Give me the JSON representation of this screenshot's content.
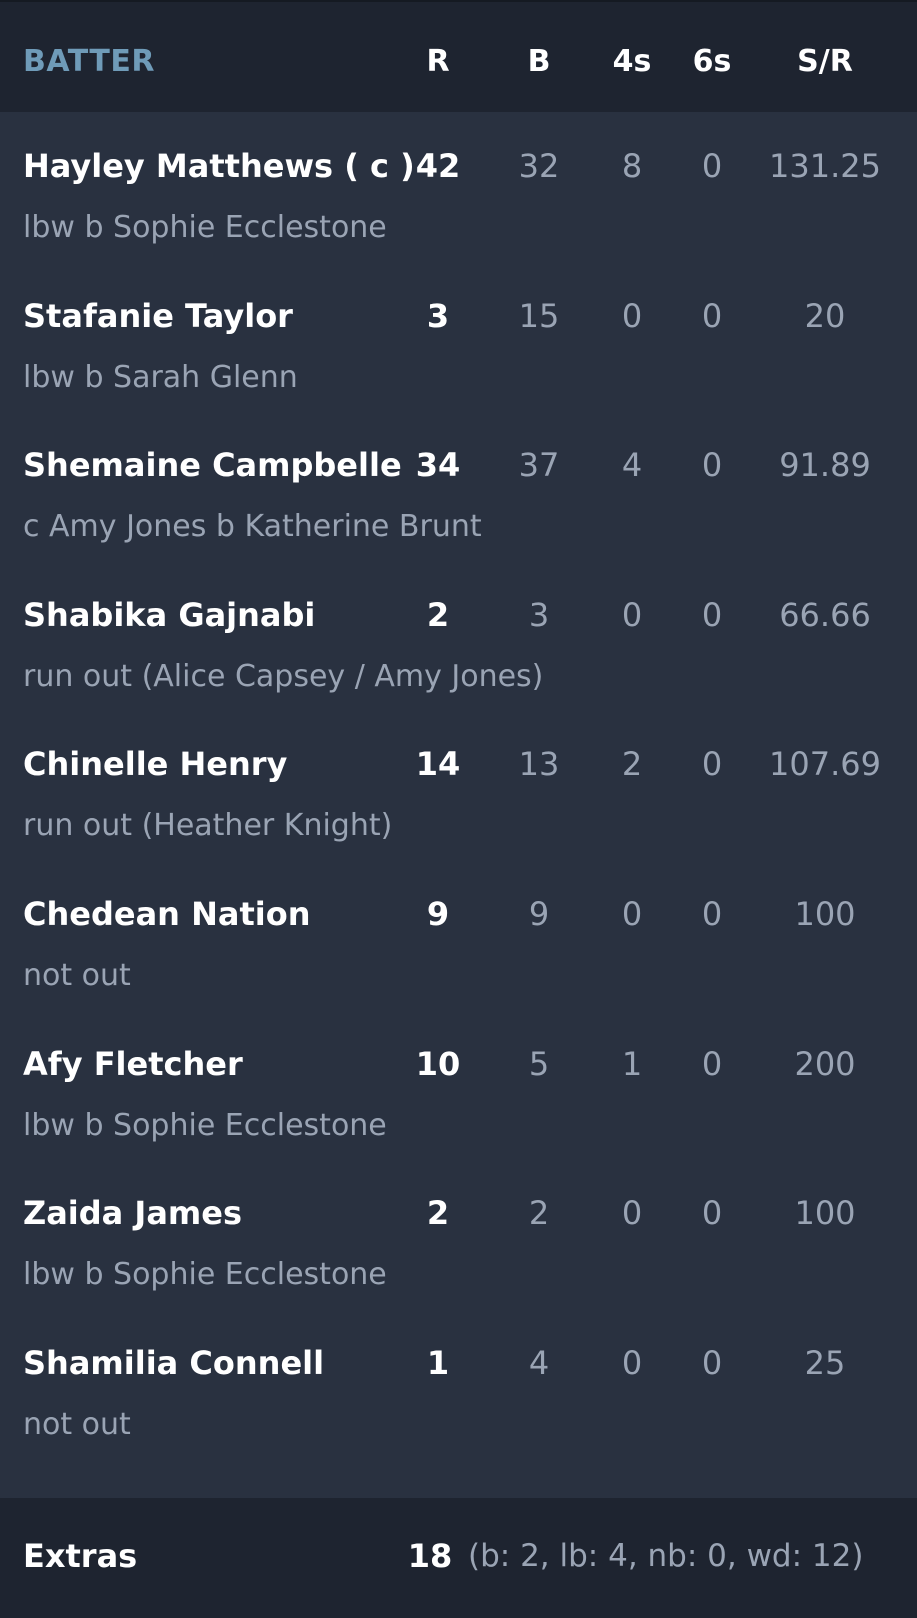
{
  "header": {
    "batter": "BATTER",
    "r": "R",
    "b": "B",
    "fours": "4s",
    "sixes": "6s",
    "sr": "S/R"
  },
  "batters": [
    {
      "name": "Hayley Matthews ( c )",
      "dismissal": "lbw b Sophie Ecclestone",
      "r": "42",
      "b": "32",
      "fours": "8",
      "sixes": "0",
      "sr": "131.25"
    },
    {
      "name": "Stafanie Taylor",
      "dismissal": "lbw b Sarah Glenn",
      "r": "3",
      "b": "15",
      "fours": "0",
      "sixes": "0",
      "sr": "20"
    },
    {
      "name": "Shemaine Campbelle",
      "dismissal": "c Amy Jones b Katherine Brunt",
      "r": "34",
      "b": "37",
      "fours": "4",
      "sixes": "0",
      "sr": "91.89"
    },
    {
      "name": "Shabika Gajnabi",
      "dismissal": "run out (Alice Capsey / Amy Jones)",
      "r": "2",
      "b": "3",
      "fours": "0",
      "sixes": "0",
      "sr": "66.66"
    },
    {
      "name": "Chinelle Henry",
      "dismissal": "run out (Heather Knight)",
      "r": "14",
      "b": "13",
      "fours": "2",
      "sixes": "0",
      "sr": "107.69"
    },
    {
      "name": "Chedean Nation",
      "dismissal": "not out",
      "r": "9",
      "b": "9",
      "fours": "0",
      "sixes": "0",
      "sr": "100"
    },
    {
      "name": "Afy Fletcher",
      "dismissal": "lbw b Sophie Ecclestone",
      "r": "10",
      "b": "5",
      "fours": "1",
      "sixes": "0",
      "sr": "200"
    },
    {
      "name": "Zaida James",
      "dismissal": "lbw b Sophie Ecclestone",
      "r": "2",
      "b": "2",
      "fours": "0",
      "sixes": "0",
      "sr": "100"
    },
    {
      "name": "Shamilia Connell",
      "dismissal": "not out",
      "r": "1",
      "b": "4",
      "fours": "0",
      "sixes": "0",
      "sr": "25"
    }
  ],
  "extras": {
    "label": "Extras",
    "total": "18",
    "detail": "(b: 2, lb: 4, nb: 0, wd: 12)"
  }
}
